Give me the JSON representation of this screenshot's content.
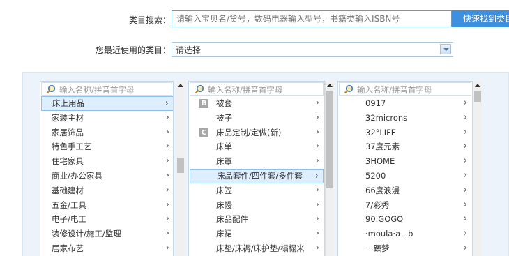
{
  "search": {
    "label": "类目搜索：",
    "placeholder": "请输入宝贝名/货号，数码电器输入型号，书籍类输入ISBN号",
    "button": "快速找到类目"
  },
  "recent": {
    "label": "您最近使用的类目：",
    "value": "请选择"
  },
  "columns": [
    {
      "placeholder": "输入名称/拼音首字母",
      "items": [
        {
          "label": "床上用品",
          "selected": true
        },
        {
          "label": "家装主材"
        },
        {
          "label": "家居饰品"
        },
        {
          "label": "特色手工艺"
        },
        {
          "label": "住宅家具"
        },
        {
          "label": "商业/办公家具"
        },
        {
          "label": "基础建材"
        },
        {
          "label": "五金/工具"
        },
        {
          "label": "电子/电工"
        },
        {
          "label": "装修设计/施工/监理"
        },
        {
          "label": "居家布艺"
        }
      ]
    },
    {
      "placeholder": "输入名称/拼音首字母",
      "items": [
        {
          "group": "B",
          "label": "被套"
        },
        {
          "label": "被子"
        },
        {
          "group": "C",
          "label": "床品定制/定做(新)"
        },
        {
          "label": "床单"
        },
        {
          "label": "床罩"
        },
        {
          "label": "床品套件/四件套/多件套",
          "selected": true
        },
        {
          "label": "床笠"
        },
        {
          "label": "床幔"
        },
        {
          "label": "床品配件"
        },
        {
          "label": "床裙"
        },
        {
          "label": "床垫/床褥/床护垫/榻榻米"
        }
      ]
    },
    {
      "placeholder": "输入名称/拼音首字母",
      "items": [
        {
          "label": "0917"
        },
        {
          "label": "32microns"
        },
        {
          "label": "32°LIFE"
        },
        {
          "label": "37度元素"
        },
        {
          "label": "3HOME"
        },
        {
          "label": "5200"
        },
        {
          "label": "66度浪漫"
        },
        {
          "label": "7/彩秀"
        },
        {
          "label": "90.GOGO"
        },
        {
          "label": "·moula·a . b"
        },
        {
          "label": "一臻梦"
        }
      ]
    }
  ],
  "icons": {
    "search": "magnifier-icon",
    "arrow": "chevron-right-icon",
    "dropdown": "chevron-down-icon"
  },
  "colors": {
    "accent": "#3d8fe0",
    "panel": "#ecf3fb",
    "selected": "#ddeeff"
  }
}
